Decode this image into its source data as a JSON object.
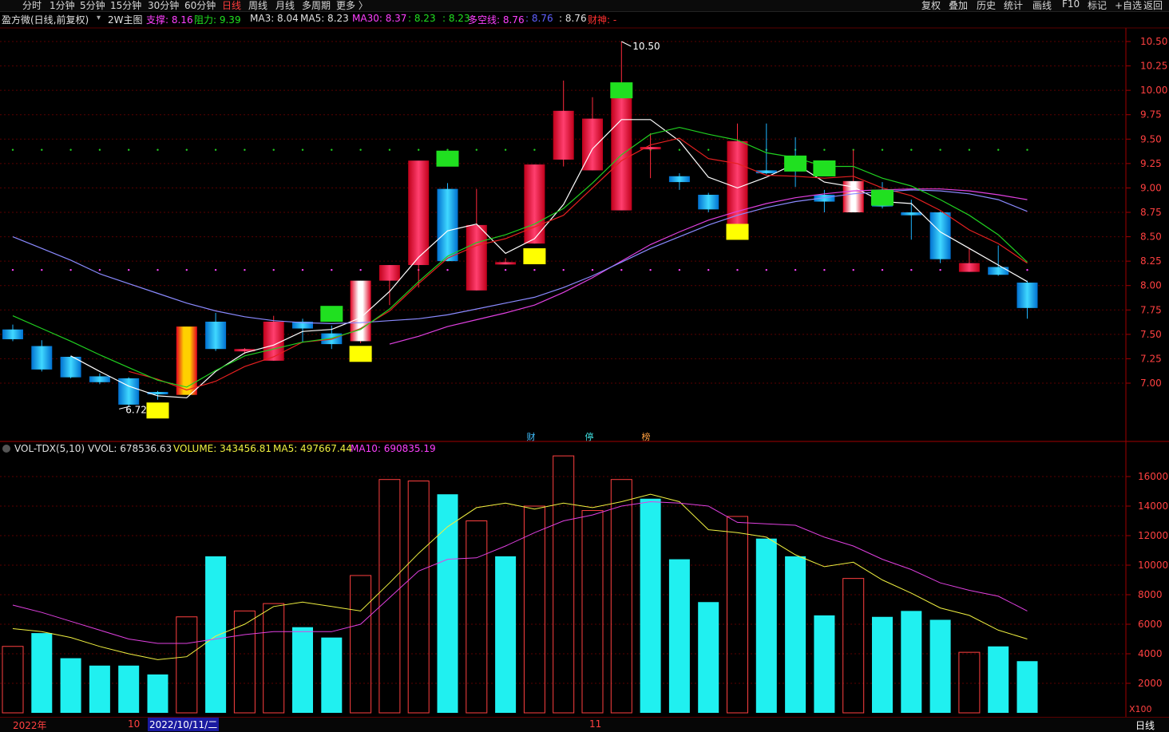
{
  "toolbar": {
    "periods": [
      "分时",
      "1分钟",
      "5分钟",
      "15分钟",
      "30分钟",
      "60分钟",
      "日线",
      "周线",
      "月线",
      "多周期",
      "更多 〉"
    ],
    "active_period": "日线",
    "right_buttons": [
      "复权",
      "叠加",
      "历史",
      "统计",
      "画线",
      "F10",
      "标记",
      "+自选",
      "返回"
    ]
  },
  "main_legend": {
    "stock": "盈方微(日线,前复权)",
    "indicator": "2W主图",
    "support_label": "支撑: 8.16",
    "resist_label": "阻力: 9.39",
    "ma3": "MA3: 8.04",
    "ma5": "MA5: 8.23",
    "ma30": "MA30: 8.37",
    "v1": ": 8.23",
    "v2": ": 8.23",
    "dkx": "多空线: 8.76",
    "v3": ": 8.76",
    "v4": ": 8.76",
    "caishen": "财神: -"
  },
  "vol_legend": {
    "name": "VOL-TDX(5,10)",
    "vvol": "VVOL: 678536.63",
    "volume": "VOLUME: 343456.81",
    "ma5": "MA5: 497667.44",
    "ma10": "MA10: 690835.19"
  },
  "colors": {
    "up": "#ff2a3c",
    "down": "#1eb4ff",
    "ma3": "#ffffff",
    "ma5": "#e62020",
    "ma30": "#e040e0",
    "dkx": "#8a8aff",
    "green_line": "#20d020",
    "vol_up": "#ff4040",
    "vol_down": "#20f0f0",
    "vol_ma5": "#f0f040",
    "vol_ma10": "#e040e0",
    "axis_text": "#ff4040",
    "grid": "#5a0000"
  },
  "markers": {
    "high": "10.50",
    "low": "6.72",
    "labels": [
      "财",
      "停",
      "榜"
    ]
  },
  "status": {
    "year": "2022年",
    "m10": "10",
    "date": "2022/10/11/二",
    "m11": "11",
    "period": "日线",
    "unit": "X100"
  },
  "chart_data": [
    {
      "type": "candlestick",
      "title": "盈方微(日线,前复权)",
      "ylim": [
        6.6,
        10.6
      ],
      "yticks": [
        "7.00",
        "7.25",
        "7.50",
        "7.75",
        "8.00",
        "8.25",
        "8.50",
        "8.75",
        "9.00",
        "9.25",
        "9.50",
        "9.75",
        "10.00",
        "10.25",
        "10.50"
      ],
      "candles": [
        {
          "o": 7.55,
          "h": 7.6,
          "l": 7.43,
          "c": 7.45
        },
        {
          "o": 7.38,
          "h": 7.44,
          "l": 7.12,
          "c": 7.14
        },
        {
          "o": 7.27,
          "h": 7.28,
          "l": 7.05,
          "c": 7.06
        },
        {
          "o": 7.07,
          "h": 7.1,
          "l": 6.99,
          "c": 7.01
        },
        {
          "o": 7.05,
          "h": 7.06,
          "l": 6.76,
          "c": 6.78
        },
        {
          "o": 6.91,
          "h": 6.92,
          "l": 6.83,
          "c": 6.89
        },
        {
          "o": 6.88,
          "h": 7.58,
          "l": 6.88,
          "c": 7.58
        },
        {
          "o": 7.63,
          "h": 7.72,
          "l": 7.33,
          "c": 7.35
        },
        {
          "o": 7.33,
          "h": 7.36,
          "l": 7.3,
          "c": 7.35
        },
        {
          "o": 7.23,
          "h": 7.69,
          "l": 7.23,
          "c": 7.63
        },
        {
          "o": 7.63,
          "h": 7.66,
          "l": 7.42,
          "c": 7.56
        },
        {
          "o": 7.51,
          "h": 7.59,
          "l": 7.35,
          "c": 7.4
        },
        {
          "o": 7.43,
          "h": 8.05,
          "l": 7.41,
          "c": 8.05
        },
        {
          "o": 8.05,
          "h": 8.21,
          "l": 7.8,
          "c": 8.21
        },
        {
          "o": 8.21,
          "h": 8.85,
          "l": 7.98,
          "c": 9.28
        },
        {
          "o": 8.99,
          "h": 9.05,
          "l": 8.25,
          "c": 8.25
        },
        {
          "o": 7.95,
          "h": 8.99,
          "l": 7.95,
          "c": 8.62
        },
        {
          "o": 8.24,
          "h": 8.28,
          "l": 8.22,
          "c": 8.24
        },
        {
          "o": 8.43,
          "h": 9.24,
          "l": 8.43,
          "c": 9.24
        },
        {
          "o": 9.29,
          "h": 10.1,
          "l": 9.22,
          "c": 9.79
        },
        {
          "o": 9.18,
          "h": 9.93,
          "l": 9.18,
          "c": 9.71
        },
        {
          "o": 8.77,
          "h": 10.5,
          "l": 8.77,
          "c": 9.99
        },
        {
          "o": 9.42,
          "h": 9.56,
          "l": 9.1,
          "c": 9.42
        },
        {
          "o": 9.12,
          "h": 9.15,
          "l": 8.98,
          "c": 9.06
        },
        {
          "o": 8.93,
          "h": 8.95,
          "l": 8.75,
          "c": 8.78
        },
        {
          "o": 8.63,
          "h": 9.66,
          "l": 8.63,
          "c": 9.48
        },
        {
          "o": 9.18,
          "h": 9.66,
          "l": 9.14,
          "c": 9.15
        },
        {
          "o": 9.25,
          "h": 9.52,
          "l": 9.01,
          "c": 9.17
        },
        {
          "o": 8.93,
          "h": 8.98,
          "l": 8.75,
          "c": 8.86
        },
        {
          "o": 8.75,
          "h": 9.39,
          "l": 8.75,
          "c": 9.07
        },
        {
          "o": 8.93,
          "h": 9.06,
          "l": 8.79,
          "c": 8.81
        },
        {
          "o": 8.75,
          "h": 8.88,
          "l": 8.47,
          "c": 8.72
        },
        {
          "o": 8.75,
          "h": 8.76,
          "l": 8.23,
          "c": 8.27
        },
        {
          "o": 8.14,
          "h": 8.38,
          "l": 8.14,
          "c": 8.23
        },
        {
          "o": 8.19,
          "h": 8.41,
          "l": 8.1,
          "c": 8.11
        },
        {
          "o": 8.03,
          "h": 8.05,
          "l": 7.66,
          "c": 7.77
        }
      ],
      "series": [
        {
          "name": "MA3",
          "values": [
            null,
            null,
            7.28,
            7.12,
            6.97,
            6.87,
            6.85,
            7.12,
            7.31,
            7.39,
            7.53,
            7.55,
            7.67,
            7.94,
            8.29,
            8.56,
            8.63,
            8.33,
            8.48,
            8.83,
            9.4,
            9.7,
            9.7,
            9.48,
            9.11,
            9.0,
            9.11,
            9.25,
            9.06,
            9.01,
            8.86,
            8.84,
            8.55,
            8.38,
            8.21,
            8.04
          ]
        },
        {
          "name": "MA5",
          "values": [
            null,
            null,
            null,
            null,
            7.12,
            7.04,
            6.93,
            7.02,
            7.17,
            7.27,
            7.42,
            7.45,
            7.56,
            7.74,
            8.02,
            8.28,
            8.41,
            8.48,
            8.6,
            8.72,
            9.0,
            9.28,
            9.44,
            9.51,
            9.3,
            9.25,
            9.13,
            9.12,
            9.1,
            9.12,
            9.0,
            8.92,
            8.77,
            8.57,
            8.43,
            8.23
          ]
        },
        {
          "name": "MA30",
          "values": [
            null,
            null,
            null,
            null,
            null,
            null,
            null,
            null,
            null,
            null,
            null,
            null,
            null,
            7.4,
            7.48,
            7.58,
            7.65,
            7.72,
            7.8,
            7.93,
            8.08,
            8.25,
            8.42,
            8.55,
            8.67,
            8.76,
            8.84,
            8.9,
            8.94,
            8.97,
            8.98,
            8.99,
            8.99,
            8.97,
            8.93,
            8.88
          ]
        },
        {
          "name": "多空线",
          "values": [
            8.5,
            8.38,
            8.26,
            8.12,
            8.02,
            7.92,
            7.82,
            7.74,
            7.68,
            7.64,
            7.62,
            7.61,
            7.62,
            7.64,
            7.66,
            7.7,
            7.76,
            7.82,
            7.88,
            7.98,
            8.1,
            8.24,
            8.38,
            8.5,
            8.62,
            8.72,
            8.8,
            8.86,
            8.9,
            8.94,
            8.96,
            8.98,
            8.97,
            8.94,
            8.88,
            8.76
          ]
        },
        {
          "name": "green",
          "values": [
            7.69,
            7.56,
            7.43,
            7.29,
            7.16,
            7.03,
            6.96,
            7.13,
            7.28,
            7.35,
            7.42,
            7.46,
            7.55,
            7.76,
            8.04,
            8.3,
            8.44,
            8.52,
            8.63,
            8.79,
            9.05,
            9.34,
            9.55,
            9.62,
            9.55,
            9.49,
            9.36,
            9.31,
            9.22,
            9.22,
            9.1,
            9.02,
            8.88,
            8.72,
            8.52,
            8.24
          ]
        }
      ],
      "upper_dots": 9.39,
      "lower_dots": 8.16,
      "signal_boxes": [
        {
          "index": 5,
          "color": "#ffff00",
          "value": 6.72
        },
        {
          "index": 11,
          "color": "#20e020",
          "value": 7.71
        },
        {
          "index": 12,
          "color": "#ffff00",
          "value": 7.3
        },
        {
          "index": 15,
          "color": "#20e020",
          "value": 9.3
        },
        {
          "index": 18,
          "color": "#ffff00",
          "value": 8.3
        },
        {
          "index": 21,
          "color": "#20e020",
          "value": 10.0
        },
        {
          "index": 25,
          "color": "#ffff00",
          "value": 8.55
        },
        {
          "index": 27,
          "color": "#20e020",
          "value": 9.25
        },
        {
          "index": 28,
          "color": "#20e020",
          "value": 9.2
        },
        {
          "index": 30,
          "color": "#20e020",
          "value": 8.9
        }
      ]
    },
    {
      "type": "bar",
      "title": "VOL-TDX(5,10)",
      "ylim": [
        0,
        17500
      ],
      "yticks": [
        "2000",
        "4000",
        "6000",
        "8000",
        "10000",
        "12000",
        "14000",
        "16000"
      ],
      "values": [
        4500,
        5400,
        3700,
        3200,
        3200,
        2600,
        6500,
        10600,
        6900,
        7400,
        5800,
        5100,
        9300,
        15800,
        15700,
        14800,
        13000,
        10600,
        14000,
        17400,
        13700,
        15800,
        14500,
        10400,
        7500,
        13300,
        11800,
        10600,
        6600,
        9100,
        6500,
        6900,
        6300,
        4100,
        4500,
        3500
      ],
      "up": [
        true,
        false,
        false,
        false,
        false,
        false,
        true,
        false,
        true,
        true,
        false,
        false,
        true,
        true,
        true,
        false,
        true,
        false,
        true,
        true,
        true,
        true,
        false,
        false,
        false,
        true,
        false,
        false,
        false,
        true,
        false,
        false,
        false,
        true,
        false,
        false
      ],
      "series": [
        {
          "name": "MA5",
          "values": [
            5700,
            5500,
            5100,
            4500,
            4000,
            3600,
            3800,
            5200,
            6000,
            7200,
            7500,
            7200,
            6900,
            8800,
            10800,
            12600,
            13900,
            14200,
            13800,
            14200,
            13900,
            14300,
            14800,
            14300,
            12400,
            12200,
            11900,
            10700,
            9900,
            10200,
            9000,
            8100,
            7100,
            6600,
            5600,
            5000
          ]
        },
        {
          "name": "MA10",
          "values": [
            7300,
            6800,
            6200,
            5600,
            5000,
            4700,
            4700,
            5000,
            5300,
            5500,
            5500,
            5500,
            6000,
            7800,
            9600,
            10400,
            10500,
            11300,
            12200,
            13000,
            13400,
            14000,
            14300,
            14200,
            14000,
            12900,
            12800,
            12700,
            11900,
            11300,
            10400,
            9700,
            8800,
            8300,
            7900,
            6900
          ]
        }
      ]
    }
  ]
}
